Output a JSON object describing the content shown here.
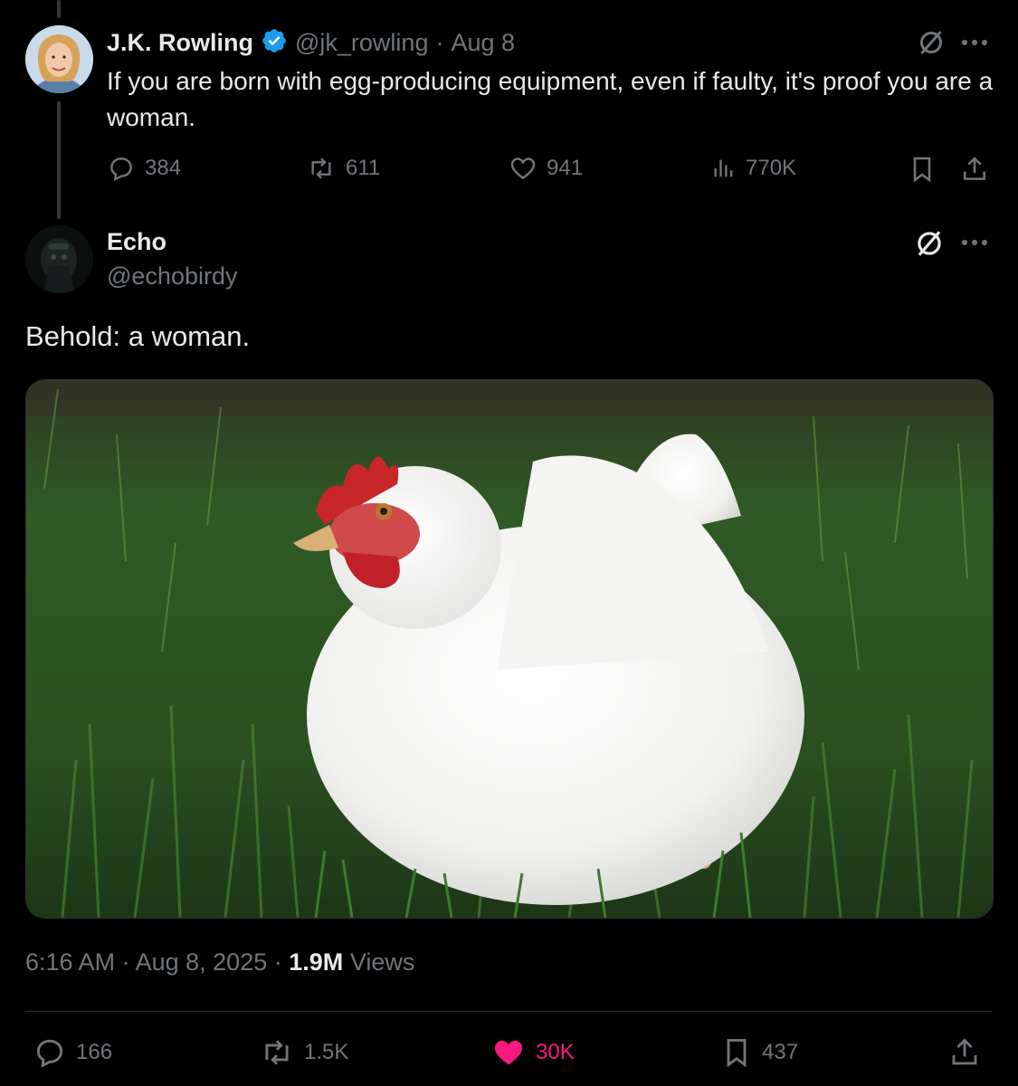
{
  "parent_tweet": {
    "author_name": "J.K. Rowling",
    "handle": "@jk_rowling",
    "separator": "·",
    "date": "Aug 8",
    "text": "If you are born with egg-producing equipment, even if faulty, it's proof you are a woman.",
    "replies": "384",
    "reposts": "611",
    "likes": "941",
    "views": "770K"
  },
  "reply_tweet": {
    "author_name": "Echo",
    "handle": "@echobirdy",
    "text": "Behold: a woman.",
    "time": "6:16 AM",
    "sep1": "·",
    "date": "Aug 8, 2025",
    "sep2": "·",
    "views_count": "1.9M",
    "views_label": "Views",
    "replies": "166",
    "reposts": "1.5K",
    "likes": "30K",
    "bookmarks": "437"
  },
  "icons": [
    "verified-badge-icon",
    "grok-icon",
    "more-icon",
    "reply-icon",
    "repost-icon",
    "like-icon",
    "views-icon",
    "bookmark-icon",
    "share-icon"
  ],
  "colors": {
    "background": "#000000",
    "text": "#e7e9ea",
    "muted": "#71767b",
    "verified": "#1d9bf0",
    "liked": "#f91880"
  }
}
